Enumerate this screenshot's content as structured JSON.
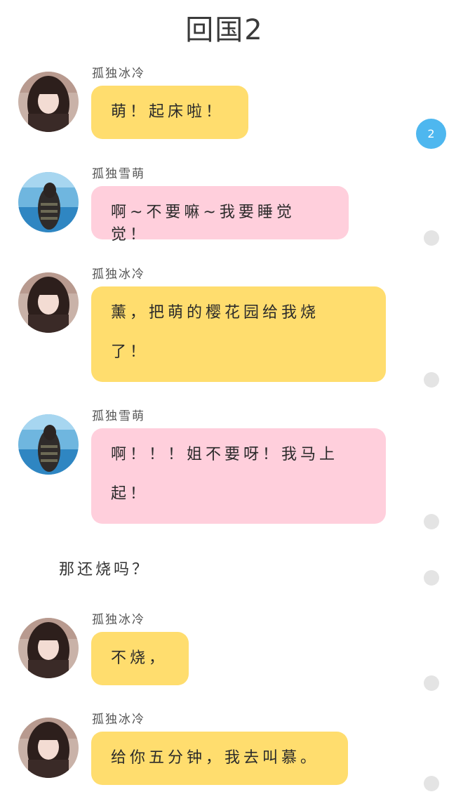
{
  "title": "回国2",
  "messages": [
    {
      "sender": "孤独冰冷",
      "text": "萌！起床啦！",
      "color": "#ffdd6e",
      "avatar": "avatar-1"
    },
    {
      "sender": "孤独雪萌",
      "text": "啊~不要嘛~我要睡觉觉！",
      "color": "#ffcfdc",
      "avatar": "avatar-2"
    },
    {
      "sender": "孤独冰冷",
      "text": "薰，把萌的樱花园给我烧了！",
      "color": "#ffdd6e",
      "avatar": "avatar-1"
    },
    {
      "sender": "孤独雪萌",
      "text": "啊！！！姐不要呀！我马上起！",
      "color": "#ffcfdc",
      "avatar": "avatar-2"
    },
    {
      "sender": "孤独冰冷",
      "text": "不烧，",
      "color": "#ffdd6e",
      "avatar": "avatar-1"
    },
    {
      "sender": "孤独冰冷",
      "text": "给你五分钟，我去叫慕。",
      "color": "#ffdd6e",
      "avatar": "avatar-1"
    }
  ],
  "narration": "那还烧吗？",
  "badge": {
    "count": "2",
    "color": "#4eb7ef"
  }
}
